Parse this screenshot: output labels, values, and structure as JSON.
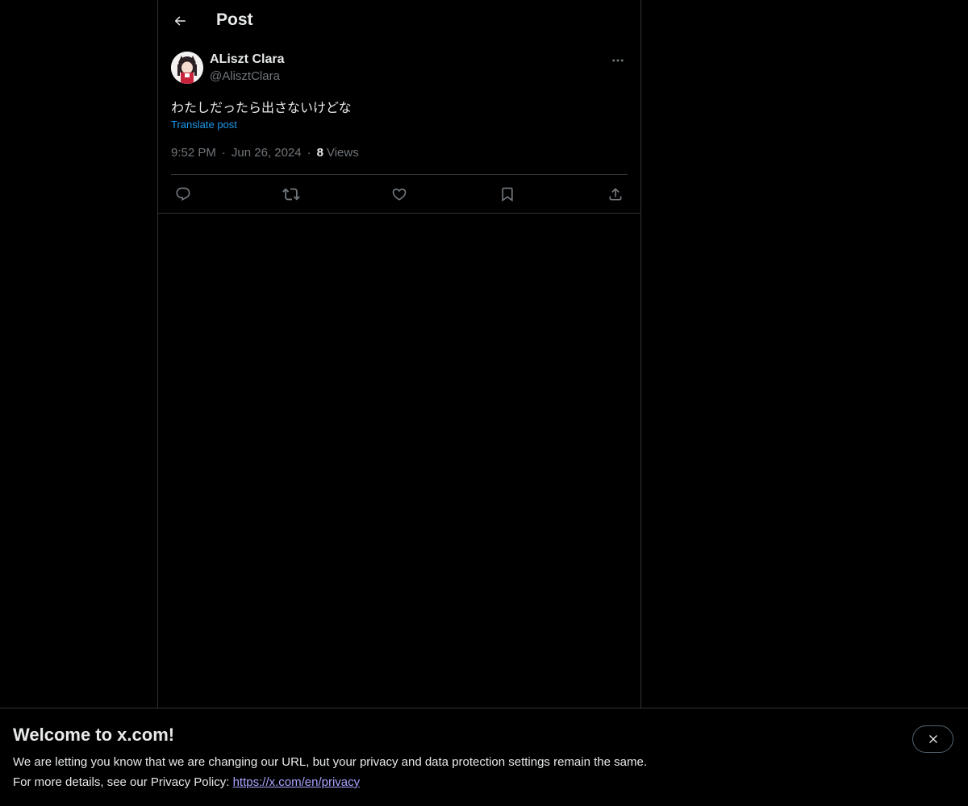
{
  "header": {
    "title": "Post",
    "back_icon": "arrow-left-icon"
  },
  "post": {
    "author_name": "ALiszt Clara",
    "author_handle": "@AlisztClara",
    "text": "わたしだったら出さないけどな",
    "translate_label": "Translate post",
    "time": "9:52 PM",
    "date": "Jun 26, 2024",
    "separator": "·",
    "views_count": "8",
    "views_label": "Views"
  },
  "actions": [
    "reply-icon",
    "repost-icon",
    "like-icon",
    "bookmark-icon",
    "share-icon"
  ],
  "banner": {
    "title": "Welcome to x.com!",
    "line1": "We are letting you know that we are changing our URL, but your privacy and data protection settings remain the same.",
    "line2_prefix": "For more details, see our Privacy Policy: ",
    "link": "https://x.com/en/privacy"
  },
  "colors": {
    "background": "#000000",
    "text_primary": "#e7e9ea",
    "text_secondary": "#71767b",
    "link": "#1d9bf0",
    "border": "#2f3336",
    "privacy_link": "#a9a3ff"
  }
}
